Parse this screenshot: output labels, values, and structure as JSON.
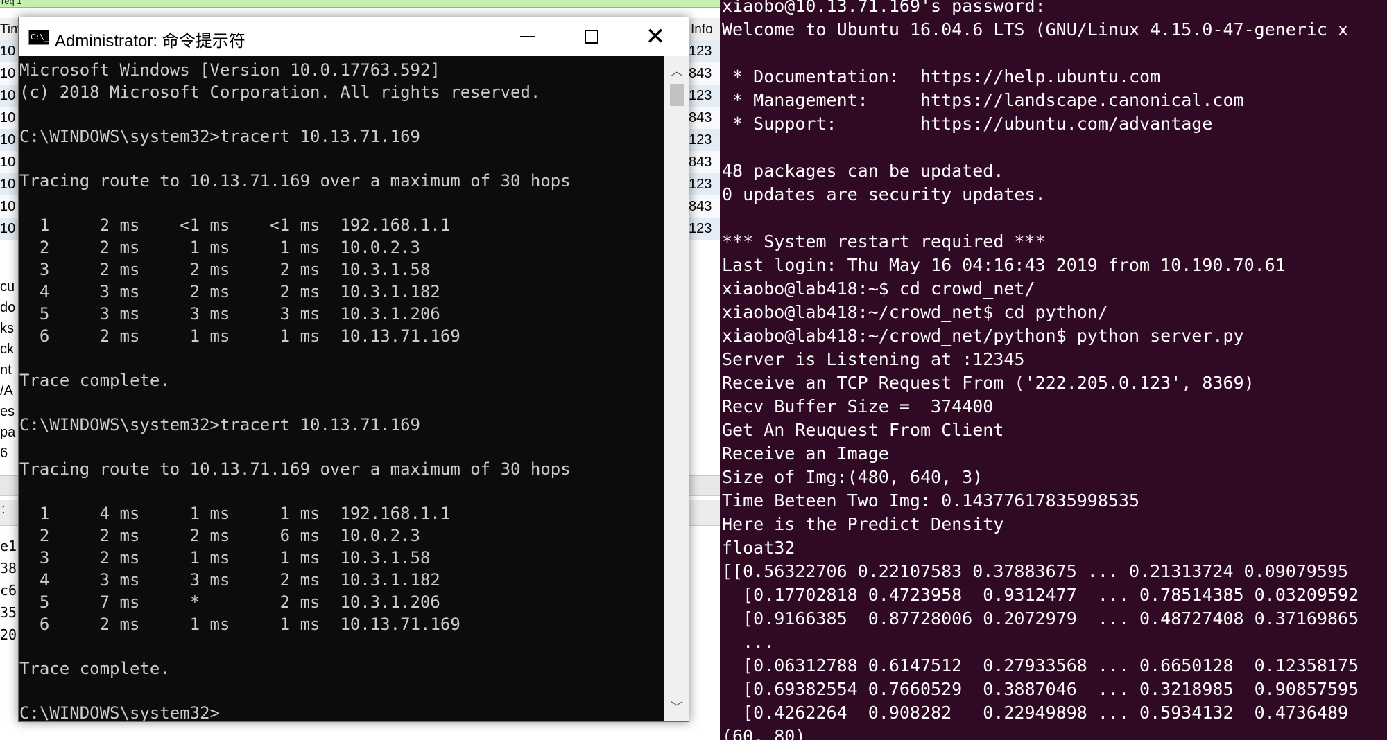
{
  "background_app": {
    "top_label": "req 1",
    "columns": [
      "Tim",
      "Info"
    ],
    "rows": [
      {
        "left": "10",
        "right": "123"
      },
      {
        "left": "10",
        "right": "843"
      },
      {
        "left": "10",
        "right": "123"
      },
      {
        "left": "10",
        "right": "843"
      },
      {
        "left": "10",
        "right": "123"
      },
      {
        "left": "10",
        "right": "843"
      },
      {
        "left": "10",
        "right": "123"
      },
      {
        "left": "10",
        "right": "843"
      },
      {
        "left": "10",
        "right": "123"
      }
    ],
    "detail_lines": [
      "cu",
      "do",
      "ks",
      "ck",
      "nt",
      "/A",
      "es",
      "pa",
      "6"
    ],
    "stripe_label": ":",
    "hex_lines": [
      "e1",
      "38",
      "c6",
      "35",
      "20"
    ]
  },
  "cmd": {
    "title": "Administrator: 命令提示符",
    "icon_text": "C:\\_",
    "lines": [
      "Microsoft Windows [Version 10.0.17763.592]",
      "(c) 2018 Microsoft Corporation. All rights reserved.",
      "",
      "C:\\WINDOWS\\system32>tracert 10.13.71.169",
      "",
      "Tracing route to 10.13.71.169 over a maximum of 30 hops",
      "",
      "  1     2 ms    <1 ms    <1 ms  192.168.1.1",
      "  2     2 ms     1 ms     1 ms  10.0.2.3",
      "  3     2 ms     2 ms     2 ms  10.3.1.58",
      "  4     3 ms     2 ms     2 ms  10.3.1.182",
      "  5     3 ms     3 ms     3 ms  10.3.1.206",
      "  6     2 ms     1 ms     1 ms  10.13.71.169",
      "",
      "Trace complete.",
      "",
      "C:\\WINDOWS\\system32>tracert 10.13.71.169",
      "",
      "Tracing route to 10.13.71.169 over a maximum of 30 hops",
      "",
      "  1     4 ms     1 ms     1 ms  192.168.1.1",
      "  2     2 ms     2 ms     6 ms  10.0.2.3",
      "  3     2 ms     1 ms     1 ms  10.3.1.58",
      "  4     3 ms     3 ms     2 ms  10.3.1.182",
      "  5     7 ms     *        2 ms  10.3.1.206",
      "  6     2 ms     1 ms     1 ms  10.13.71.169",
      "",
      "Trace complete.",
      "",
      "C:\\WINDOWS\\system32>"
    ]
  },
  "terminal": {
    "lines": [
      "xiaobo@10.13.71.169's password:",
      "Welcome to Ubuntu 16.04.6 LTS (GNU/Linux 4.15.0-47-generic x",
      "",
      " * Documentation:  https://help.ubuntu.com",
      " * Management:     https://landscape.canonical.com",
      " * Support:        https://ubuntu.com/advantage",
      "",
      "48 packages can be updated.",
      "0 updates are security updates.",
      "",
      "*** System restart required ***",
      "Last login: Thu May 16 04:16:43 2019 from 10.190.70.61",
      "xiaobo@lab418:~$ cd crowd_net/",
      "xiaobo@lab418:~/crowd_net$ cd python/",
      "xiaobo@lab418:~/crowd_net/python$ python server.py",
      "Server is Listening at :12345",
      "Receive an TCP Request From ('222.205.0.123', 8369)",
      "Recv Buffer Size =  374400",
      "Get An Reuquest From Client",
      "Receive an Image",
      "Size of Img:(480, 640, 3)",
      "Time Beteen Two Img: 0.14377617835998535",
      "Here is the Predict Density",
      "float32",
      "[[0.56322706 0.22107583 0.37883675 ... 0.21313724 0.09079595",
      "  [0.17702818 0.4723958  0.9312477  ... 0.78514385 0.03209592",
      "  [0.9166385  0.87728006 0.2072979  ... 0.48727408 0.37169865",
      "  ...",
      "  [0.06312788 0.6147512  0.27933568 ... 0.6650128  0.12358175",
      "  [0.69382554 0.7660529  0.3887046  ... 0.3218985  0.90857595",
      "  [0.4262264  0.908282   0.22949898 ... 0.5934132  0.4736489",
      "(60, 80)"
    ]
  }
}
